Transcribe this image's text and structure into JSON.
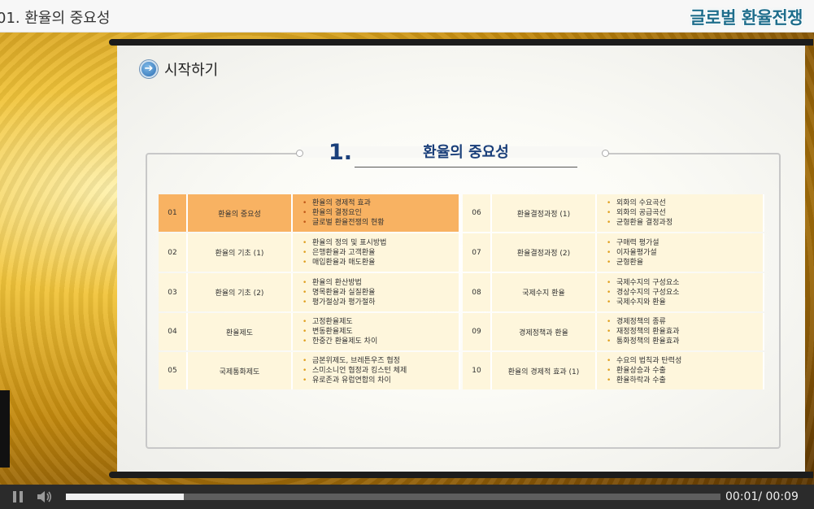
{
  "header": {
    "lesson_title": "01. 환율의 중요성",
    "brand": "글로벌 환율전쟁"
  },
  "slide": {
    "start_label": "시작하기",
    "section_number": "1.",
    "section_title": "환율의 중요성"
  },
  "toc_left": [
    {
      "num": "01",
      "title": "환율의 중요성",
      "active": true,
      "bullets": [
        "환율의 경제적 효과",
        "환율의 결정요인",
        "글로벌 환율전쟁의 현황"
      ]
    },
    {
      "num": "02",
      "title": "환율의 기초 (1)",
      "bullets": [
        "환율의 정의 및 표시방법",
        "은행환율과 고객환율",
        "매입환율과 매도환율"
      ]
    },
    {
      "num": "03",
      "title": "환율의 기초 (2)",
      "bullets": [
        "환율의 환산방법",
        "명목환율과 실질환율",
        "평가절상과 평가절하"
      ]
    },
    {
      "num": "04",
      "title": "환율제도",
      "bullets": [
        "고정환율제도",
        "변동환율제도",
        "한중간 환율제도 차이"
      ]
    },
    {
      "num": "05",
      "title": "국제통화제도",
      "bullets": [
        "금본위제도, 브레튼우즈 협정",
        "스미소니언 협정과 킹스턴 체제",
        "유로존과 유럽연합의 차이"
      ]
    }
  ],
  "toc_right": [
    {
      "num": "06",
      "title": "환율결정과정 (1)",
      "bullets": [
        "외화의 수요곡선",
        "외화의 공급곡선",
        "균형환율 결정과정"
      ]
    },
    {
      "num": "07",
      "title": "환율결정과정 (2)",
      "bullets": [
        "구매력 평가설",
        "이자율평가설",
        "균형환율"
      ]
    },
    {
      "num": "08",
      "title": "국제수지 환율",
      "bullets": [
        "국제수지의 구성요소",
        "경상수지의 구성요소",
        "국제수지와 환율"
      ]
    },
    {
      "num": "09",
      "title": "경제정책과 환율",
      "bullets": [
        "경제정책의 종류",
        "재정정책의 환율효과",
        "통화정책의 환율효과"
      ]
    },
    {
      "num": "10",
      "title": "환율의 경제적 효과 (1)",
      "bullets": [
        "수요의 법칙과 탄력성",
        "환율상승과 수출",
        "환율하락과 수출"
      ]
    }
  ],
  "player": {
    "time": "00:01/ 00:09",
    "progress_fraction": 0.18,
    "pause_icon": "pause-icon",
    "volume_icon": "volume-icon"
  }
}
